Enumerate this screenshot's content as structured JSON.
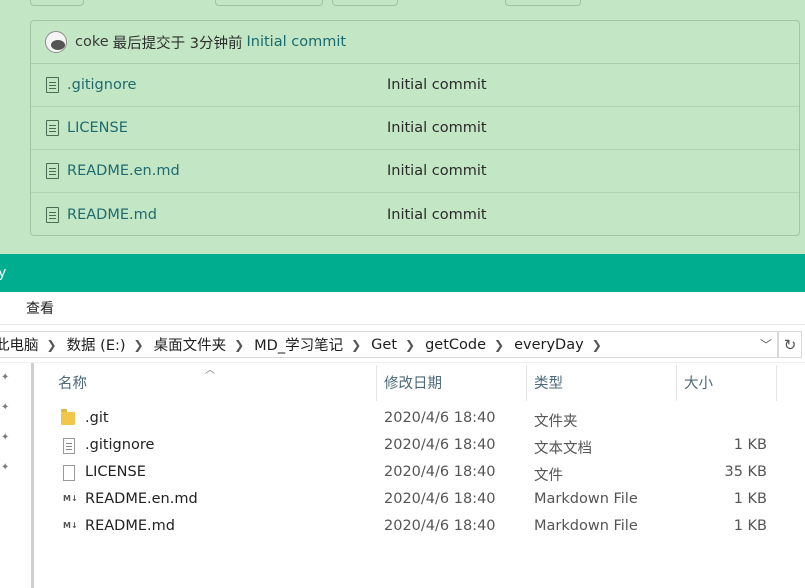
{
  "repo": {
    "commit": {
      "user": "coke",
      "text": "最后提交于 3分钟前",
      "message": "Initial commit"
    },
    "files": [
      {
        "name": ".gitignore",
        "message": "Initial commit"
      },
      {
        "name": "LICENSE",
        "message": "Initial commit"
      },
      {
        "name": "README.en.md",
        "message": "Initial commit"
      },
      {
        "name": "README.md",
        "message": "Initial commit"
      }
    ]
  },
  "explorer": {
    "title": "y",
    "ribbon": {
      "view_tab": "查看"
    },
    "breadcrumb": [
      "此电脑",
      "数据 (E:)",
      "桌面文件夹",
      "MD_学习笔记",
      "Get",
      "getCode",
      "everyDay"
    ],
    "columns": {
      "name": "名称",
      "modified": "修改日期",
      "type": "类型",
      "size": "大小"
    },
    "items": [
      {
        "name": ".git",
        "modified": "2020/4/6 18:40",
        "type": "文件夹",
        "size": "",
        "icon": "folder-icon"
      },
      {
        "name": ".gitignore",
        "modified": "2020/4/6 18:40",
        "type": "文本文档",
        "size": "1 KB",
        "icon": "text-file-icon"
      },
      {
        "name": "LICENSE",
        "modified": "2020/4/6 18:40",
        "type": "文件",
        "size": "35 KB",
        "icon": "file-icon"
      },
      {
        "name": "README.en.md",
        "modified": "2020/4/6 18:40",
        "type": "Markdown File",
        "size": "1 KB",
        "icon": "markdown-file-icon"
      },
      {
        "name": "README.md",
        "modified": "2020/4/6 18:40",
        "type": "Markdown File",
        "size": "1 KB",
        "icon": "markdown-file-icon"
      }
    ]
  },
  "colors": {
    "title_bar": "#00ad8e",
    "repo_background": "#c3e6c4",
    "link": "#1f6b70"
  }
}
